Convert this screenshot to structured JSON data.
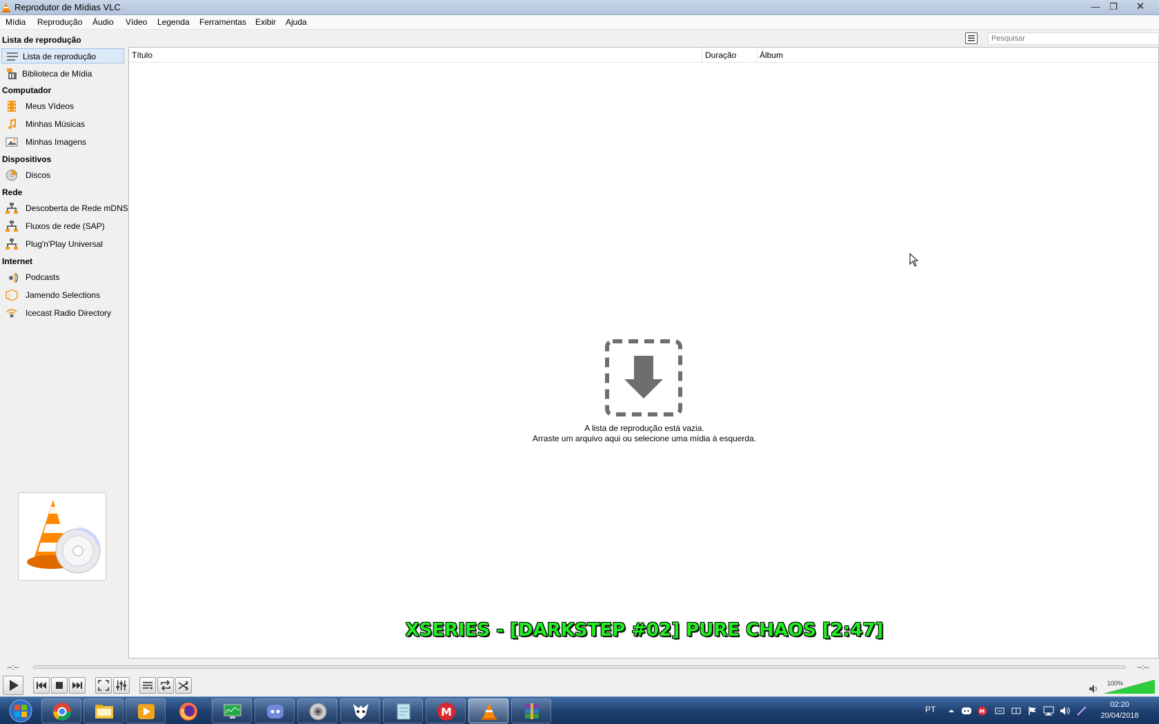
{
  "window": {
    "title": "Reprodutor de Mídias VLC",
    "minimize": "—",
    "maximize": "❐",
    "close": "✕"
  },
  "menu": [
    "Mídia",
    "Reprodução",
    "Áudio",
    "Vídeo",
    "Legenda",
    "Ferramentas",
    "Exibir",
    "Ajuda"
  ],
  "sidebar": {
    "sections": {
      "playlist": "Lista de reprodução",
      "computer": "Computador",
      "devices": "Dispositivos",
      "network": "Rede",
      "internet": "Internet"
    },
    "items": [
      {
        "label": "Lista de reprodução",
        "icon": "playlist-icon"
      },
      {
        "label": "Biblioteca de Mídia",
        "icon": "media-library-icon"
      },
      {
        "label": "Meus Vídeos",
        "icon": "film-icon"
      },
      {
        "label": "Minhas Músicas",
        "icon": "music-note-icon"
      },
      {
        "label": "Minhas Imagens",
        "icon": "picture-icon"
      },
      {
        "label": "Discos",
        "icon": "disc-icon"
      },
      {
        "label": "Descoberta de Rede mDNS",
        "icon": "network-icon"
      },
      {
        "label": "Fluxos de rede (SAP)",
        "icon": "network-icon"
      },
      {
        "label": "Plug'n'Play Universal",
        "icon": "network-icon"
      },
      {
        "label": "Podcasts",
        "icon": "podcast-icon"
      },
      {
        "label": "Jamendo Selections",
        "icon": "jamendo-icon"
      },
      {
        "label": "Icecast Radio Directory",
        "icon": "radio-icon"
      }
    ]
  },
  "search": {
    "placeholder": "Pesquisar"
  },
  "playlist": {
    "columns": [
      "Título",
      "Duração",
      "Álbum"
    ],
    "empty_line1": "A lista de reprodução está vazia.",
    "empty_line2": "Arraste um arquivo aqui ou selecione uma mídia à esquerda."
  },
  "now_playing": "XSERIES - [DARKSTEP #02] PURE CHAOS [2:47]",
  "seek": {
    "elapsed": "--:--",
    "remaining": "--:--",
    "position": 0
  },
  "volume": {
    "label": "100%",
    "level": 1.0
  },
  "taskbar": {
    "apps": [
      "chrome",
      "explorer",
      "media-player",
      "firefox",
      "monitor",
      "discord",
      "speaker",
      "foobar",
      "notepad",
      "mega",
      "vlc",
      "winrar"
    ],
    "language": "PT",
    "time": "02:20",
    "date": "20/04/2018"
  },
  "colors": {
    "accent": "#ff8800",
    "now_playing": "#22ee22",
    "selection": "#dbe9f8"
  }
}
